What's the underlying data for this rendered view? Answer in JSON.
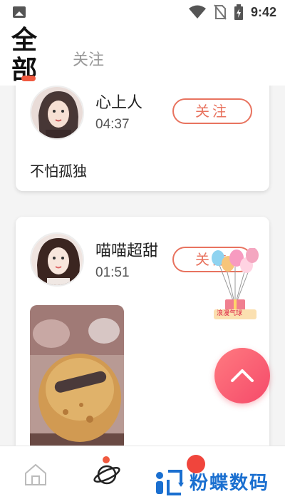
{
  "status_bar": {
    "time": "9:42",
    "icons": [
      "photo-icon",
      "wifi-icon",
      "no-sim-icon",
      "battery-charging-icon"
    ]
  },
  "header": {
    "tabs": [
      {
        "label": "全部",
        "active": true
      },
      {
        "label": "关注",
        "active": false
      }
    ],
    "accent_color": "#f05a40"
  },
  "feed": {
    "posts": [
      {
        "username": "心上人",
        "time": "04:37",
        "follow_label": "关注",
        "text": "不怕孤独"
      },
      {
        "username": "喵喵超甜",
        "time": "01:51",
        "follow_label": "关注",
        "text": ""
      }
    ]
  },
  "floating": {
    "gift_label": "浪漫气球",
    "scroll_top_icon": "chevron-up-icon"
  },
  "bottom_nav": {
    "items": [
      "home-icon",
      "planet-icon",
      "message-icon",
      "profile-icon"
    ]
  },
  "watermark": {
    "text": "粉蝶数码",
    "color": "#1a6fd0"
  }
}
